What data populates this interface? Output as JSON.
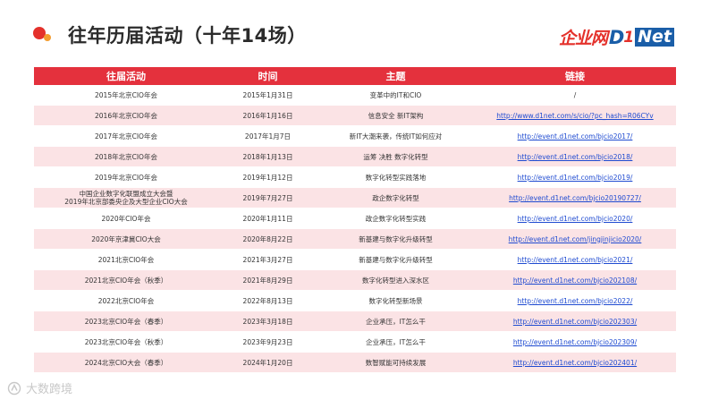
{
  "header": {
    "title": "往年历届活动（十年14场）",
    "logo_cn": "企业网",
    "logo_d": "D",
    "logo_one": "1",
    "logo_net": "Net"
  },
  "table": {
    "columns": [
      "往届活动",
      "时间",
      "主题",
      "链接"
    ],
    "rows": [
      {
        "event": "2015年北京CIO年会",
        "date": "2015年1月31日",
        "theme": "变革中的IT和CIO",
        "link": "/"
      },
      {
        "event": "2016年北京CIO年会",
        "date": "2016年1月16日",
        "theme": "信息安全 新IT架构",
        "link": "http://www.d1net.com/s/cio/?pc_hash=R06CYv"
      },
      {
        "event": "2017年北京CIO年会",
        "date": "2017年1月7日",
        "theme": "新IT大潮来袭，传统IT如何应对",
        "link": "http://event.d1net.com/bjcio2017/"
      },
      {
        "event": "2018年北京CIO年会",
        "date": "2018年1月13日",
        "theme": "运筹 决胜 数字化转型",
        "link": "http://event.d1net.com/bjcio2018/"
      },
      {
        "event": "2019年北京CIO年会",
        "date": "2019年1月12日",
        "theme": "数字化转型实践落地",
        "link": "http://event.d1net.com/bjcio2019/"
      },
      {
        "event": "中国企业数字化联盟成立大会暨\n2019年北京部委央企及大型企业CIO大会",
        "date": "2019年7月27日",
        "theme": "政企数字化转型",
        "link": "http://event.d1net.com/bjcio20190727/"
      },
      {
        "event": "2020年CIO年会",
        "date": "2020年1月11日",
        "theme": "政企数字化转型实践",
        "link": "http://event.d1net.com/bjcio2020/"
      },
      {
        "event": "2020年京津冀CIO大会",
        "date": "2020年8月22日",
        "theme": "新基建与数字化升级转型",
        "link": "http://event.d1net.com/jingjinjicio2020/"
      },
      {
        "event": "2021北京CIO年会",
        "date": "2021年3月27日",
        "theme": "新基建与数字化升级转型",
        "link": "http://event.d1net.com/bjcio2021/"
      },
      {
        "event": "2021北京CIO年会（秋季）",
        "date": "2021年8月29日",
        "theme": "数字化转型进入深水区",
        "link": "http://event.d1net.com/bjcio202108/"
      },
      {
        "event": "2022北京CIO年会",
        "date": "2022年8月13日",
        "theme": "数字化转型新场景",
        "link": "http://event.d1net.com/bjcio2022/"
      },
      {
        "event": "2023北京CIO年会（春季）",
        "date": "2023年3月18日",
        "theme": "企业承压，IT怎么干",
        "link": "http://event.d1net.com/bjcio202303/"
      },
      {
        "event": "2023北京CIO年会（秋季）",
        "date": "2023年9月23日",
        "theme": "企业承压，IT怎么干",
        "link": "http://event.d1net.com/bjcio202309/"
      },
      {
        "event": "2024北京CIO大会（春季）",
        "date": "2024年1月20日",
        "theme": "数智赋能可持续发展",
        "link": "http://event.d1net.com/bjcio202401/"
      }
    ]
  },
  "watermark": {
    "text": "大数跨境"
  },
  "colors": {
    "accent_red": "#e4313d",
    "row_alt": "#fbe3e5",
    "link_blue": "#1f4bd1",
    "logo_blue": "#1a5ea8"
  },
  "icons": {
    "title_decoration": "red-orange-dots",
    "watermark_icon": "brand-mark-icon"
  }
}
